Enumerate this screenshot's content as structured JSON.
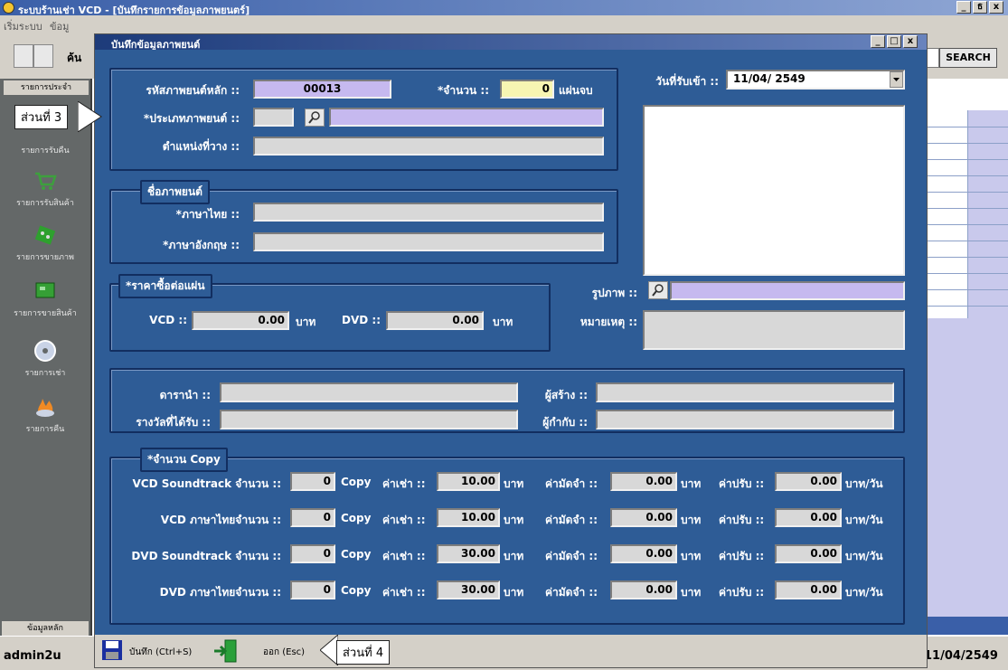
{
  "main_window": {
    "title": "ระบบร้านเช่า VCD - [บันทึกรายการข้อมูลภาพยนตร์]",
    "menu": [
      "เริ่มระบบ",
      "ข้อมู"
    ],
    "controls": [
      "_",
      "ธ",
      "x"
    ],
    "search_label": "ค้น",
    "search_button": "SEARCH"
  },
  "left_panel": {
    "header": "รายการประจำ",
    "items": [
      "รายการรับคืน",
      "รายการรับสินค้า",
      "รายการขายภาพ",
      "รายการขายสินค้า",
      "รายการเช่า",
      "รายการคืน"
    ],
    "footer": "ข้อมูลหลัก"
  },
  "status": {
    "user": "admin2u",
    "date": "11/04/2549"
  },
  "dialog": {
    "title": "บันทึกข้อมูลภาพยนต์",
    "controls": [
      "_",
      "□",
      "x"
    ],
    "movie_id_label": "รหัสภาพยนต์หลัก ::",
    "movie_id": "00013",
    "count_label": "*จำนวน ::",
    "count": "0",
    "count_unit": "แผ่นจบ",
    "type_label": "*ประเภทภาพยนต์ ::",
    "type_code": "",
    "type_name": "",
    "location_label": "ตำแหน่งที่วาง ::",
    "location": "",
    "name_group": "ชื่อภาพยนต์",
    "thai_label": "*ภาษาไทย ::",
    "thai_name": "",
    "eng_label": "*ภาษาอังกฤษ ::",
    "eng_name": "",
    "price_group": "*ราคาซื้อต่อแผ่น",
    "vcd_label": "VCD ::",
    "vcd_price": "0.00",
    "baht": "บาท",
    "dvd_label": "DVD ::",
    "dvd_price": "0.00",
    "date_label": "วันที่รับเข้า ::",
    "date": "11/04/ 2549",
    "image_label": "รูปภาพ ::",
    "image_path": "",
    "note_label": "หมายเหตุ ::",
    "note": "",
    "actor_label": "ดารานำ ::",
    "actor": "",
    "director_label": "ผู้สร้าง ::",
    "director": "",
    "award_label": "รางวัลที่ได้รับ ::",
    "award": "",
    "producer_label": "ผู้กำกับ ::",
    "producer": "",
    "copy_group": "*จำนวน Copy",
    "copy_rows": [
      {
        "label": "VCD Soundtrack จำนวน ::",
        "count": "0",
        "unit": "Copy",
        "rent_label": "ค่าเช่า ::",
        "rent": "10.00",
        "rent_unit": "บาท",
        "deposit_label": "ค่ามัดจำ ::",
        "deposit": "0.00",
        "deposit_unit": "บาท",
        "fine_label": "ค่าปรับ ::",
        "fine": "0.00",
        "fine_unit": "บาท/วัน"
      },
      {
        "label": "VCD ภาษาไทยจำนวน ::",
        "count": "0",
        "unit": "Copy",
        "rent_label": "ค่าเช่า ::",
        "rent": "10.00",
        "rent_unit": "บาท",
        "deposit_label": "ค่ามัดจำ ::",
        "deposit": "0.00",
        "deposit_unit": "บาท",
        "fine_label": "ค่าปรับ ::",
        "fine": "0.00",
        "fine_unit": "บาท/วัน"
      },
      {
        "label": "DVD Soundtrack จำนวน ::",
        "count": "0",
        "unit": "Copy",
        "rent_label": "ค่าเช่า ::",
        "rent": "30.00",
        "rent_unit": "บาท",
        "deposit_label": "ค่ามัดจำ ::",
        "deposit": "0.00",
        "deposit_unit": "บาท",
        "fine_label": "ค่าปรับ ::",
        "fine": "0.00",
        "fine_unit": "บาท/วัน"
      },
      {
        "label": "DVD ภาษาไทยจำนวน ::",
        "count": "0",
        "unit": "Copy",
        "rent_label": "ค่าเช่า ::",
        "rent": "30.00",
        "rent_unit": "บาท",
        "deposit_label": "ค่ามัดจำ ::",
        "deposit": "0.00",
        "deposit_unit": "บาท",
        "fine_label": "ค่าปรับ ::",
        "fine": "0.00",
        "fine_unit": "บาท/วัน"
      }
    ],
    "save_label": "บันทึก (Ctrl+S)",
    "exit_label": "ออก (Esc)"
  },
  "callouts": {
    "part3": "ส่วนที่ 3",
    "part4": "ส่วนที่ 4"
  },
  "colors": {
    "dialog_bg": "#2e5c96",
    "field": "#d8d8d8",
    "field_purple": "#c6b9ef",
    "field_yellow": "#f7f5b2"
  }
}
